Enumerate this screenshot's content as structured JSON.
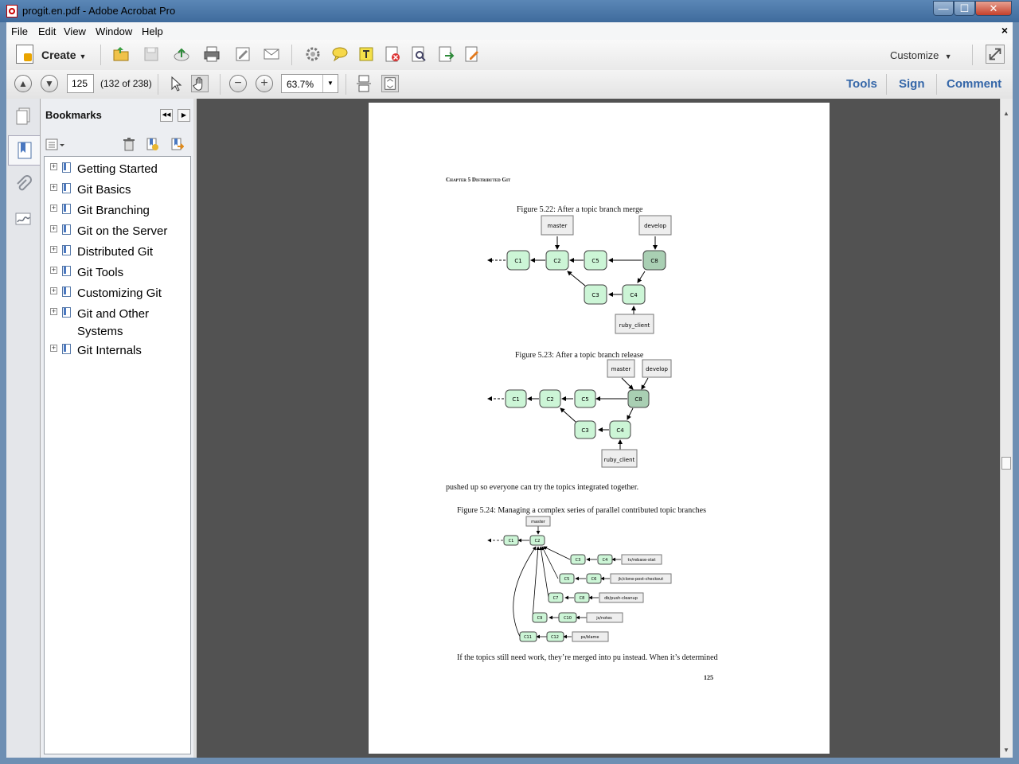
{
  "window": {
    "title": "progit.en.pdf - Adobe Acrobat Pro",
    "min": "—",
    "max": "☐",
    "close": "✕"
  },
  "menubar": {
    "items": [
      "File",
      "Edit",
      "View",
      "Window",
      "Help"
    ],
    "close_doc": "×"
  },
  "toolbar": {
    "create_label": "Create",
    "create_arrow": "▼",
    "customize_label": "Customize",
    "customize_arrow": "▼"
  },
  "nav": {
    "page_number": "125",
    "page_count": "(132 of 238)",
    "zoom": "63.7%",
    "zoom_arrow": "▼",
    "prev_page": "▲",
    "next_page": "▼",
    "zoom_out": "−",
    "zoom_in": "+"
  },
  "right_links": {
    "tools": "Tools",
    "sign": "Sign",
    "comment": "Comment"
  },
  "bookmarks": {
    "title": "Bookmarks",
    "collapse": "◀◀",
    "expand": "▶",
    "items": [
      {
        "label": "Getting Started"
      },
      {
        "label": "Git Basics"
      },
      {
        "label": "Git Branching"
      },
      {
        "label": "Git on the Server"
      },
      {
        "label": "Distributed Git"
      },
      {
        "label": "Git Tools"
      },
      {
        "label": "Customizing Git"
      },
      {
        "label": "Git and Other Systems"
      },
      {
        "label": "Git Internals"
      }
    ]
  },
  "document": {
    "header": "Chapter 5 Distributed Git",
    "fig22_caption": "Figure 5.22:  After a topic branch merge",
    "fig23_caption": "Figure 5.23:  After a topic branch release",
    "text1": "pushed up so everyone can try the topics integrated together.",
    "fig24_caption": "Figure 5.24:  Managing a complex series of parallel contributed topic branches",
    "text2": "If the topics still need work, they’re merged into pu instead. When it’s determined",
    "page_number": "125",
    "fig22": {
      "refs": [
        "master",
        "develop",
        "ruby_client"
      ],
      "commits": [
        "C1",
        "C2",
        "C5",
        "C8",
        "C3",
        "C4"
      ]
    },
    "fig23": {
      "refs": [
        "master",
        "develop",
        "ruby_client"
      ],
      "commits": [
        "C1",
        "C2",
        "C5",
        "C8",
        "C3",
        "C4"
      ]
    },
    "fig24": {
      "refs": [
        "master",
        "tv/rebase-stat",
        "jk/clone-post-checkout",
        "db/push-cleanup",
        "js/notes",
        "ps/blame"
      ],
      "commits": [
        "C1",
        "C2",
        "C3",
        "C4",
        "C5",
        "C6",
        "C7",
        "C8",
        "C9",
        "C10",
        "C11",
        "C12"
      ]
    }
  },
  "colors": {
    "commit_fill": "#ccf5d6",
    "commit_dark": "#a9cfb3",
    "ref_fill": "#eeeeee",
    "link": "#3466a8"
  }
}
